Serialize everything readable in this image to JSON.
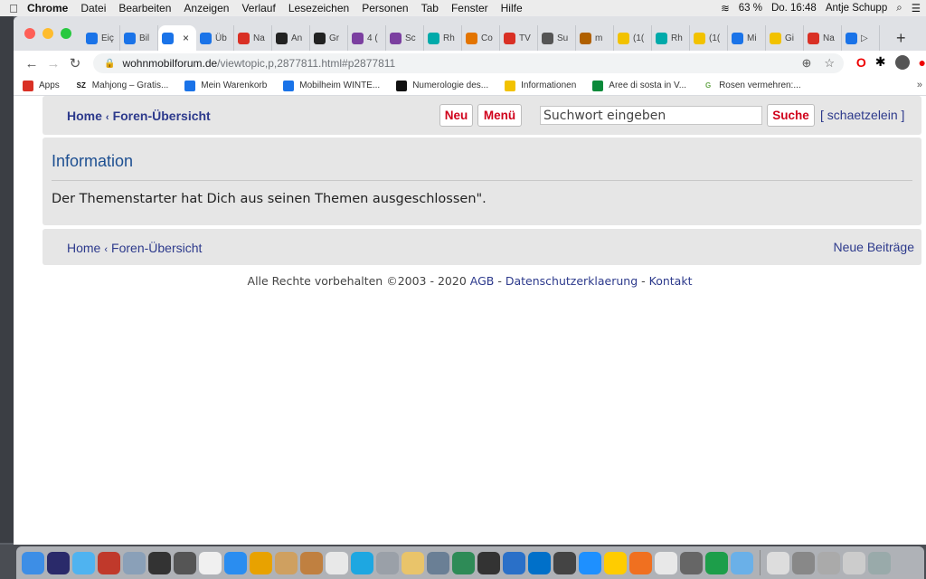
{
  "menubar": {
    "apple": "",
    "items": [
      "Chrome",
      "Datei",
      "Bearbeiten",
      "Anzeigen",
      "Verlauf",
      "Lesezeichen",
      "Personen",
      "Tab",
      "Fenster",
      "Hilfe"
    ],
    "battery": "63 %",
    "clock": "Do. 16:48",
    "user": "Antje Schupp"
  },
  "tabs": [
    {
      "label": "Eiç",
      "color": "#1a73e8"
    },
    {
      "label": "Bil",
      "color": "#1a73e8"
    },
    {
      "label": "",
      "color": "#1a73e8",
      "active": true
    },
    {
      "label": "Üb",
      "color": "#1a73e8"
    },
    {
      "label": "Na",
      "color": "#d93025"
    },
    {
      "label": "An",
      "color": "#222"
    },
    {
      "label": "Gr",
      "color": "#222"
    },
    {
      "label": "4 (",
      "color": "#7b3fa0"
    },
    {
      "label": "Sc",
      "color": "#7b3fa0"
    },
    {
      "label": "Rh",
      "color": "#0aa"
    },
    {
      "label": "Co",
      "color": "#e37400"
    },
    {
      "label": "TV",
      "color": "#d93025"
    },
    {
      "label": "Su",
      "color": "#555"
    },
    {
      "label": "m",
      "color": "#b06000"
    },
    {
      "label": "(1(",
      "color": "#f2c200"
    },
    {
      "label": "Rh",
      "color": "#0aa"
    },
    {
      "label": "(1(",
      "color": "#f2c200"
    },
    {
      "label": "Mi",
      "color": "#1a73e8"
    },
    {
      "label": "Gi",
      "color": "#f2c200"
    },
    {
      "label": "Na",
      "color": "#d93025"
    },
    {
      "label": "▷",
      "color": "#1a73e8"
    }
  ],
  "active_tab_close": "×",
  "new_tab": "+",
  "url": {
    "domain": "wohnmobilforum.de",
    "path": "/viewtopic,p,2877811.html#p2877811"
  },
  "bookmarks": [
    {
      "label": "Apps",
      "color": "#d93025"
    },
    {
      "label": "Mahjong – Gratis...",
      "color": "#111",
      "icon_text": "SZ"
    },
    {
      "label": "Mein Warenkorb",
      "color": "#1a73e8"
    },
    {
      "label": "Mobilheim WINTE...",
      "color": "#1a73e8"
    },
    {
      "label": "Numerologie des...",
      "color": "#111"
    },
    {
      "label": "Informationen",
      "color": "#f2c200"
    },
    {
      "label": "Aree di sosta in V...",
      "color": "#0a8a3a"
    },
    {
      "label": "Rosen vermehren:...",
      "color": "#6aa84f",
      "icon_text": "G"
    }
  ],
  "bookmarks_more": "»",
  "forum": {
    "nav": {
      "home": "Home",
      "sep": "‹",
      "overview": "Foren-Übersicht",
      "btn_new": "Neu",
      "btn_menu": "Menü",
      "search_placeholder": "Suchwort eingeben",
      "btn_search": "Suche",
      "user": "[ schaetzelein ]"
    },
    "info_title": "Information",
    "info_message": "Der Themenstarter hat Dich aus seinen Themen ausgeschlossen\".",
    "bottom": {
      "home": "Home",
      "sep": "‹",
      "overview": "Foren-Übersicht",
      "new_posts": "Neue Beiträge"
    },
    "footer": {
      "copyright": "Alle Rechte vorbehalten ©2003 - 2020",
      "agb": "AGB",
      "dash1": " - ",
      "privacy": "Datenschutzerklaerung",
      "dash2": " - ",
      "contact": "Kontakt"
    }
  },
  "dock_colors": [
    "#3d8ee6",
    "#2a2a6a",
    "#4fb3f0",
    "#c0392b",
    "#8aa0b8",
    "#333",
    "#555",
    "#f0f0f0",
    "#2a8df0",
    "#e8a200",
    "#cfa060",
    "#c08040",
    "#e8e8e8",
    "#1ea7e1",
    "#9aa0a8",
    "#e9c46a",
    "#6a7f95",
    "#2e8b57",
    "#333",
    "#2a70c8",
    "#0070c9",
    "#444",
    "#1e90ff",
    "#ffcc00",
    "#f07020",
    "#e8e8e8",
    "#666",
    "#1d9e4a",
    "#6ab0e8",
    "#ddd",
    "#888",
    "#aaa",
    "#ccc",
    "#9aa"
  ]
}
